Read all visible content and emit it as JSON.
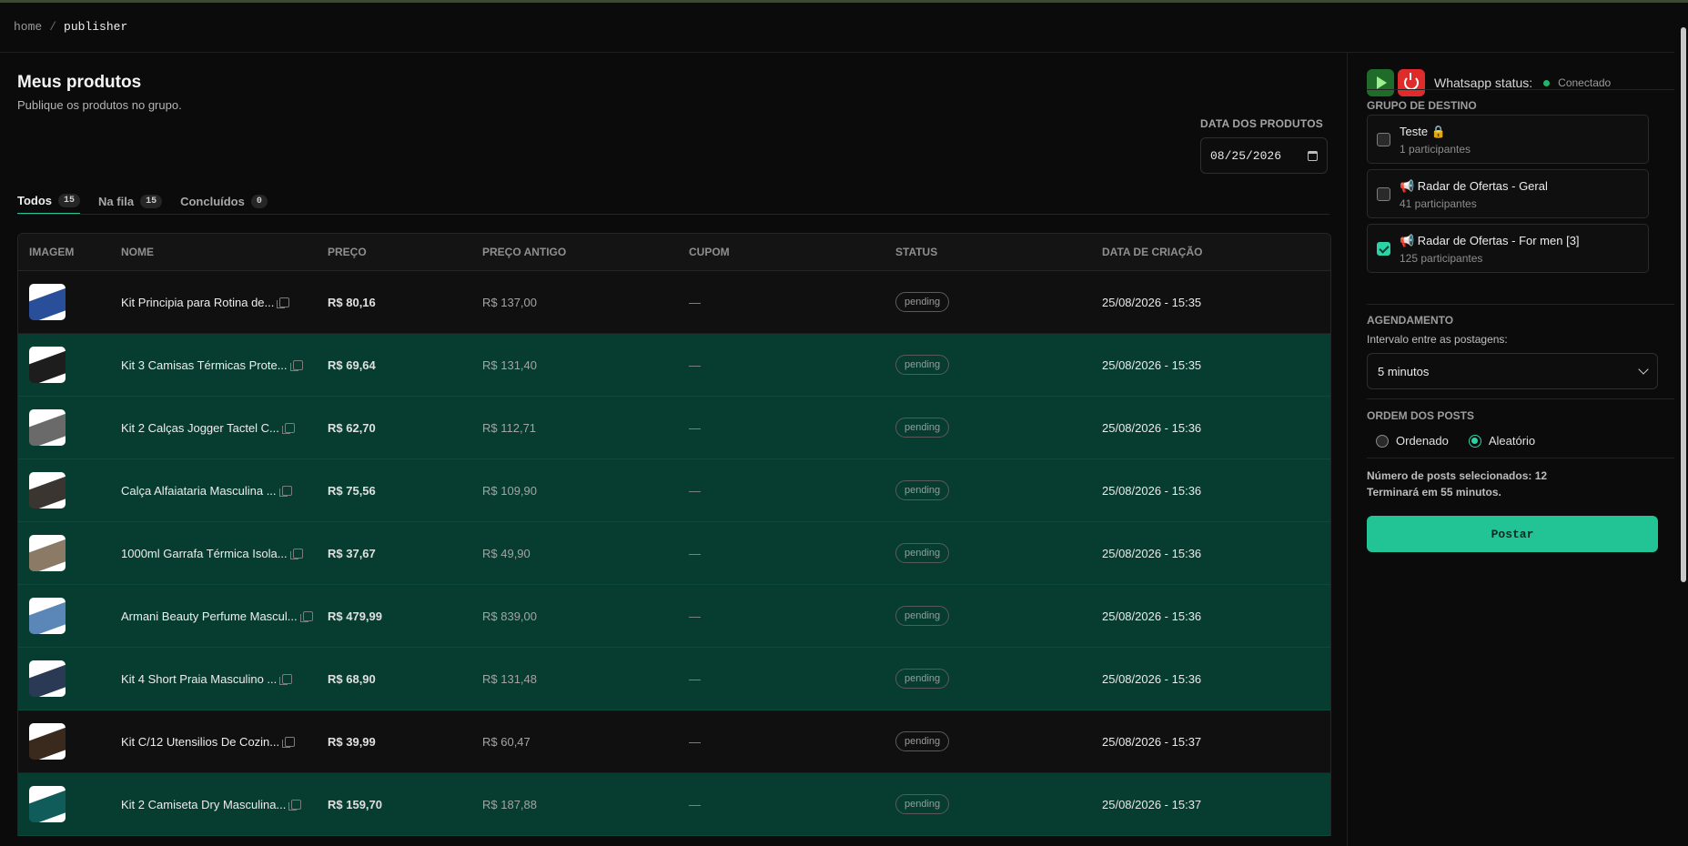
{
  "breadcrumb": {
    "home": "home",
    "separator": "/",
    "current": "publisher"
  },
  "page": {
    "title": "Meus produtos",
    "subtitle": "Publique os produtos no grupo."
  },
  "date_filter": {
    "label": "DATA DOS PRODUTOS",
    "value": "08/25/2026"
  },
  "tabs": [
    {
      "label": "Todos",
      "count": "15",
      "active": true
    },
    {
      "label": "Na fila",
      "count": "15",
      "active": false
    },
    {
      "label": "Concluídos",
      "count": "0",
      "active": false
    }
  ],
  "table": {
    "headers": [
      "IMAGEM",
      "NOME",
      "PREÇO",
      "PREÇO ANTIGO",
      "CUPOM",
      "STATUS",
      "DATA DE CRIAÇÃO"
    ],
    "rows": [
      {
        "name": "Kit Principia para Rotina de...",
        "price": "R$ 80,16",
        "old_price": "R$ 137,00",
        "coupon": "—",
        "status": "pending",
        "created": "25/08/2026 - 15:35",
        "selected": false,
        "thumb_color": "#2a4f9a"
      },
      {
        "name": "Kit 3 Camisas Térmicas Prote...",
        "price": "R$ 69,64",
        "old_price": "R$ 131,40",
        "coupon": "—",
        "status": "pending",
        "created": "25/08/2026 - 15:35",
        "selected": true,
        "thumb_color": "#1d1d1d"
      },
      {
        "name": "Kit 2 Calças Jogger Tactel C...",
        "price": "R$ 62,70",
        "old_price": "R$ 112,71",
        "coupon": "—",
        "status": "pending",
        "created": "25/08/2026 - 15:36",
        "selected": true,
        "thumb_color": "#6a6a6a"
      },
      {
        "name": "Calça Alfaiataria Masculina ...",
        "price": "R$ 75,56",
        "old_price": "R$ 109,90",
        "coupon": "—",
        "status": "pending",
        "created": "25/08/2026 - 15:36",
        "selected": true,
        "thumb_color": "#3a3530"
      },
      {
        "name": "1000ml Garrafa Térmica Isola...",
        "price": "R$ 37,67",
        "old_price": "R$ 49,90",
        "coupon": "—",
        "status": "pending",
        "created": "25/08/2026 - 15:36",
        "selected": true,
        "thumb_color": "#8a7a66"
      },
      {
        "name": "Armani Beauty Perfume Mascul...",
        "price": "R$ 479,99",
        "old_price": "R$ 839,00",
        "coupon": "—",
        "status": "pending",
        "created": "25/08/2026 - 15:36",
        "selected": true,
        "thumb_color": "#5a86b8"
      },
      {
        "name": "Kit 4 Short Praia Masculino ...",
        "price": "R$ 68,90",
        "old_price": "R$ 131,48",
        "coupon": "—",
        "status": "pending",
        "created": "25/08/2026 - 15:36",
        "selected": true,
        "thumb_color": "#2a3a55"
      },
      {
        "name": "Kit C/12 Utensilios De Cozin...",
        "price": "R$ 39,99",
        "old_price": "R$ 60,47",
        "coupon": "—",
        "status": "pending",
        "created": "25/08/2026 - 15:37",
        "selected": false,
        "thumb_color": "#3a2a1e"
      },
      {
        "name": "Kit 2 Camiseta Dry Masculina...",
        "price": "R$ 159,70",
        "old_price": "R$ 187,88",
        "coupon": "—",
        "status": "pending",
        "created": "25/08/2026 - 15:37",
        "selected": true,
        "thumb_color": "#0f5c5a"
      }
    ]
  },
  "sidebar": {
    "whatsapp_label": "Whatsapp status:",
    "whatsapp_status": "Conectado",
    "groups_label": "GRUPO DE DESTINO",
    "groups": [
      {
        "name": "Teste 🔒",
        "participants": "1 participantes",
        "checked": false
      },
      {
        "name": "📢 Radar de Ofertas - Geral",
        "participants": "41 participantes",
        "checked": false
      },
      {
        "name": "📢 Radar de Ofertas - For men [3]",
        "participants": "125 participantes",
        "checked": true
      }
    ],
    "schedule_label": "AGENDAMENTO",
    "interval_label": "Intervalo entre as postagens:",
    "interval_value": "5 minutos",
    "order_label": "ORDEM DOS POSTS",
    "order_options": [
      {
        "label": "Ordenado",
        "selected": false
      },
      {
        "label": "Aleatório",
        "selected": true
      }
    ],
    "selected_count_text": "Número de posts selecionados: 12",
    "finish_text": "Terminará em 55 minutos.",
    "post_button": "Postar"
  }
}
